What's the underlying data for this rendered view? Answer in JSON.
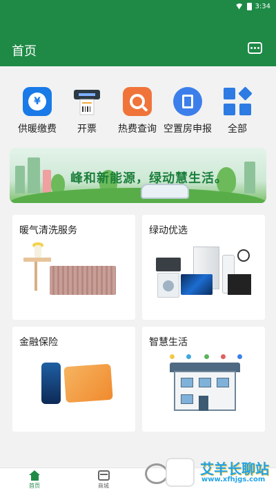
{
  "status_bar": {
    "time": "3:34"
  },
  "header": {
    "title": "首页"
  },
  "quick_actions": [
    {
      "label": "供暖缴费",
      "icon": "heating-payment-icon"
    },
    {
      "label": "开票",
      "icon": "invoice-printer-icon"
    },
    {
      "label": "热费查询",
      "icon": "search-icon"
    },
    {
      "label": "空置房申报",
      "icon": "document-report-icon"
    },
    {
      "label": "全部",
      "icon": "all-grid-icon"
    }
  ],
  "banner": {
    "text": "峰和新能源，绿动慧生活。"
  },
  "cards": [
    {
      "title": "暖气清洗服务"
    },
    {
      "title": "绿动优选"
    },
    {
      "title": "金融保险"
    },
    {
      "title": "智慧生活"
    }
  ],
  "bottom_nav": [
    {
      "label": "首页",
      "icon": "home-icon"
    },
    {
      "label": "商城",
      "icon": "store-icon"
    }
  ],
  "watermark": {
    "text": "艾羊长聊站",
    "url": "www.xfhjgs.com"
  },
  "colors": {
    "primary": "#1e8a46",
    "background": "#f2f2f2"
  }
}
